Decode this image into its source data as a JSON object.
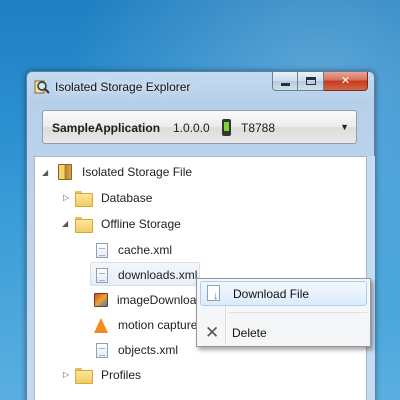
{
  "window": {
    "title": "Isolated Storage Explorer",
    "caption_buttons": {
      "minimize_icon": "minimize-icon",
      "maximize_icon": "maximize-icon",
      "close_icon": "close-icon"
    }
  },
  "device": {
    "app_name": "SampleApplication",
    "version": "1.0.0.0",
    "device_icon": "phone-icon",
    "device_id": "T8788"
  },
  "tree": {
    "root": {
      "label": "Isolated Storage File",
      "expanded": true
    },
    "items": [
      {
        "label": "Database",
        "type": "folder",
        "expanded": false
      },
      {
        "label": "Offline Storage",
        "type": "folder",
        "expanded": true
      },
      {
        "label": "cache.xml",
        "type": "file"
      },
      {
        "label": "downloads.xml",
        "type": "file",
        "selected": true
      },
      {
        "label": "imageDownloa",
        "type": "image-file"
      },
      {
        "label": "motion capture",
        "type": "video-file"
      },
      {
        "label": "objects.xml",
        "type": "file"
      },
      {
        "label": "Profiles",
        "type": "folder",
        "expanded": false
      }
    ]
  },
  "context_menu": {
    "items": [
      {
        "label": "Download File",
        "icon": "download-file-icon",
        "highlighted": true
      },
      {
        "label": "Delete",
        "icon": "delete-icon"
      }
    ]
  },
  "colors": {
    "desktop": "#2b8fd0",
    "window_frame": "#c4dbf0",
    "close_button": "#c4391c",
    "menu_highlight": "#dcebfb"
  }
}
